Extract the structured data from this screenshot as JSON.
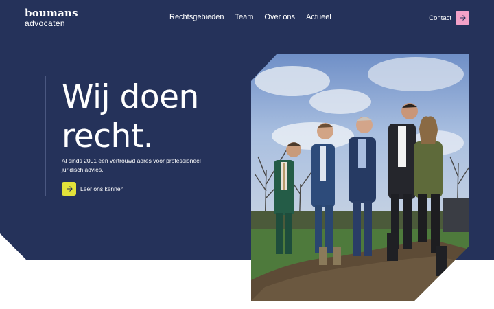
{
  "brand": {
    "line1": "boumans",
    "line2": "advocaten"
  },
  "nav": {
    "items": [
      {
        "label": "Rechtsgebieden"
      },
      {
        "label": "Team"
      },
      {
        "label": "Over ons"
      },
      {
        "label": "Actueel"
      }
    ],
    "contact_label": "Contact",
    "contact_icon": "arrow-right-icon"
  },
  "hero": {
    "headline_line1": "Wij doen",
    "headline_line2": "recht.",
    "subtitle": "Al sinds 2001 een vertrouwd adres voor professioneel juridisch advies.",
    "cta_label": "Leer ons kennen",
    "cta_icon": "arrow-right-icon"
  },
  "colors": {
    "navy": "#25325a",
    "contact_button": "#f3a2c8",
    "cta_button": "#e2e23a",
    "text": "#ffffff"
  }
}
